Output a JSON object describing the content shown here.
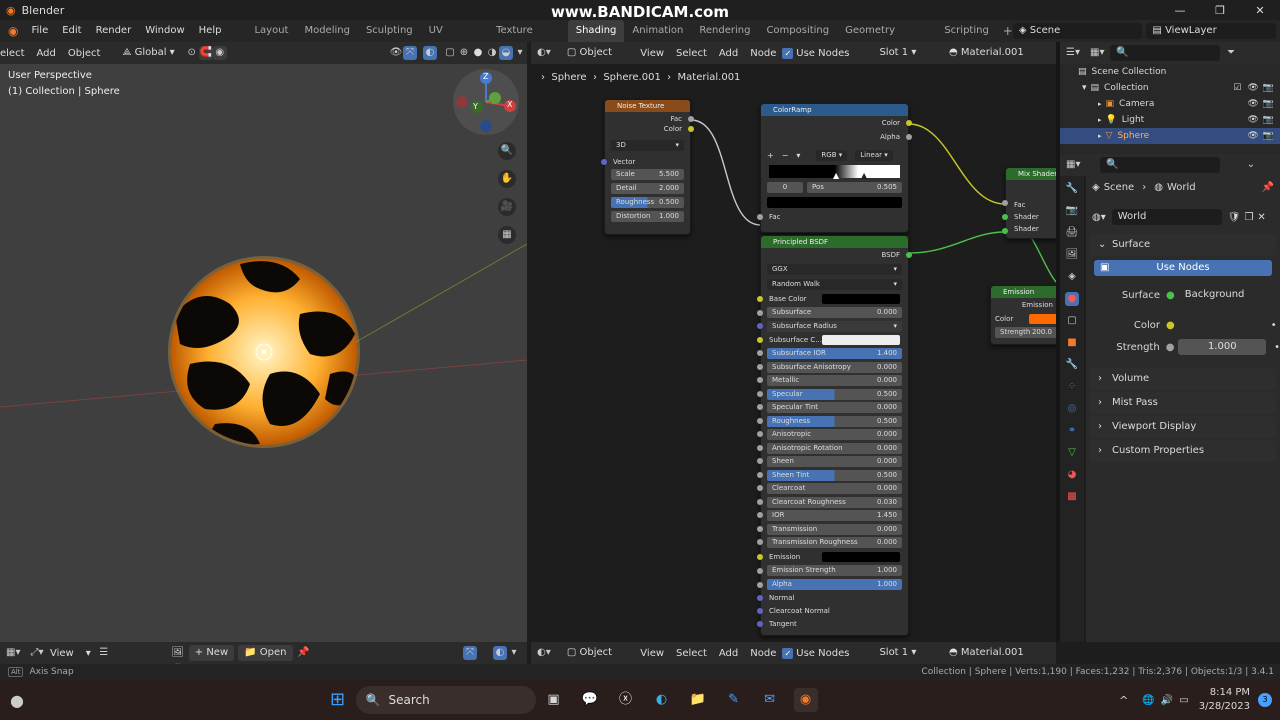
{
  "window": {
    "title": "Blender",
    "watermark": "www.BANDICAM.com"
  },
  "menus": [
    "File",
    "Edit",
    "Render",
    "Window",
    "Help"
  ],
  "workspaces": [
    {
      "label": "Layout",
      "active": false
    },
    {
      "label": "Modeling",
      "active": false
    },
    {
      "label": "Sculpting",
      "active": false
    },
    {
      "label": "UV Editing",
      "active": false
    },
    {
      "label": "Texture Paint",
      "active": false
    },
    {
      "label": "Shading",
      "active": true
    },
    {
      "label": "Animation",
      "active": false
    },
    {
      "label": "Rendering",
      "active": false
    },
    {
      "label": "Compositing",
      "active": false
    },
    {
      "label": "Geometry Nodes",
      "active": false
    },
    {
      "label": "Scripting",
      "active": false
    }
  ],
  "scene_name": "Scene",
  "view_layer": "ViewLayer",
  "viewport": {
    "header_items": [
      "elect",
      "Add",
      "Object"
    ],
    "transform_orientation": "Global",
    "overlay_title": "User Perspective",
    "overlay_sub": "(1) Collection | Sphere",
    "gizmo_labels": {
      "x": "X",
      "y": "Y",
      "z": "Z"
    }
  },
  "node_editor": {
    "object_mode": "Object",
    "menus": [
      "View",
      "Select",
      "Add",
      "Node"
    ],
    "use_nodes_label": "Use Nodes",
    "slot": "Slot 1",
    "material": "Material.001",
    "breadcrumb": [
      "Sphere",
      "Sphere.001",
      "Material.001"
    ]
  },
  "nodes": {
    "noise": {
      "title": "Noise Texture",
      "outputs": [
        "Fac",
        "Color"
      ],
      "dimension": "3D",
      "vector_label": "Vector",
      "fields": [
        {
          "label": "Scale",
          "value": "5.500"
        },
        {
          "label": "Detail",
          "value": "2.000"
        },
        {
          "label": "Roughness",
          "value": "0.500"
        },
        {
          "label": "Distortion",
          "value": "1.000"
        }
      ]
    },
    "colorramp": {
      "title": "ColorRamp",
      "outputs": [
        "Color",
        "Alpha"
      ],
      "mode": "RGB",
      "interp": "Linear",
      "index": "0",
      "pos_label": "Pos",
      "pos_value": "0.505",
      "input": "Fac"
    },
    "bsdf": {
      "title": "Principled BSDF",
      "output": "BSDF",
      "distribution": "GGX",
      "subsurface_method": "Random Walk",
      "base_color_label": "Base Color",
      "subsurface_radius_label": "Subsurface Radius",
      "subsurface_color_label": "Subsurface C...",
      "fields": [
        {
          "label": "Subsurface",
          "value": "0.000",
          "fill": 0
        },
        {
          "label": "Subsurface IOR",
          "value": "1.400",
          "fill": 1
        },
        {
          "label": "Subsurface Anisotropy",
          "value": "0.000",
          "fill": 0
        },
        {
          "label": "Metallic",
          "value": "0.000",
          "fill": 0
        },
        {
          "label": "Specular",
          "value": "0.500",
          "fill": 0.5
        },
        {
          "label": "Specular Tint",
          "value": "0.000",
          "fill": 0
        },
        {
          "label": "Roughness",
          "value": "0.500",
          "fill": 0.5
        },
        {
          "label": "Anisotropic",
          "value": "0.000",
          "fill": 0
        },
        {
          "label": "Anisotropic Rotation",
          "value": "0.000",
          "fill": 0
        },
        {
          "label": "Sheen",
          "value": "0.000",
          "fill": 0
        },
        {
          "label": "Sheen Tint",
          "value": "0.500",
          "fill": 0.5
        },
        {
          "label": "Clearcoat",
          "value": "0.000",
          "fill": 0
        },
        {
          "label": "Clearcoat Roughness",
          "value": "0.030",
          "fill": 0
        },
        {
          "label": "IOR",
          "value": "1.450",
          "fill": 0
        },
        {
          "label": "Transmission",
          "value": "0.000",
          "fill": 0
        },
        {
          "label": "Transmission Roughness",
          "value": "0.000",
          "fill": 0
        }
      ],
      "emission_label": "Emission",
      "emission_strength": {
        "label": "Emission Strength",
        "value": "1.000"
      },
      "alpha": {
        "label": "Alpha",
        "value": "1.000",
        "fill": 1
      },
      "tail": [
        "Normal",
        "Clearcoat Normal",
        "Tangent"
      ]
    },
    "mix": {
      "title": "Mix Shader",
      "inputs": [
        "Fac",
        "Shader",
        "Shader"
      ]
    },
    "emission": {
      "title": "Emission",
      "output": "Emission",
      "color_label": "Color",
      "strength_label": "Strength",
      "strength_value": "200.0"
    }
  },
  "outliner": {
    "root": "Scene Collection",
    "collection": "Collection",
    "items": [
      {
        "label": "Camera",
        "selected": false
      },
      {
        "label": "Light",
        "selected": false
      },
      {
        "label": "Sphere",
        "selected": true
      }
    ]
  },
  "properties": {
    "breadcrumb": [
      "Scene",
      "World"
    ],
    "world_name": "World",
    "surface_panel": "Surface",
    "use_nodes_button": "Use Nodes",
    "surface_label": "Surface",
    "surface_value": "Background",
    "color_label": "Color",
    "strength_label": "Strength",
    "strength_value": "1.000",
    "collapsed_panels": [
      "Volume",
      "Mist Pass",
      "Viewport Display",
      "Custom Properties"
    ]
  },
  "bottom_left": {
    "view": "View",
    "new": "New",
    "open": "Open"
  },
  "status": {
    "left": "Axis Snap",
    "right": "Collection | Sphere | Verts:1,190 | Faces:1,232 | Tris:2,376 | Objects:1/3 | 3.4.1"
  },
  "taskbar": {
    "search": "Search",
    "time": "8:14 PM",
    "date": "3/28/2023",
    "badge": "3"
  },
  "colors": {
    "accent": "#4772b3",
    "emission": "#ff6a00",
    "noise_header": "#8a4b1a",
    "shader_header": "#2b6b2b",
    "converter_header": "#2a5b8a"
  }
}
